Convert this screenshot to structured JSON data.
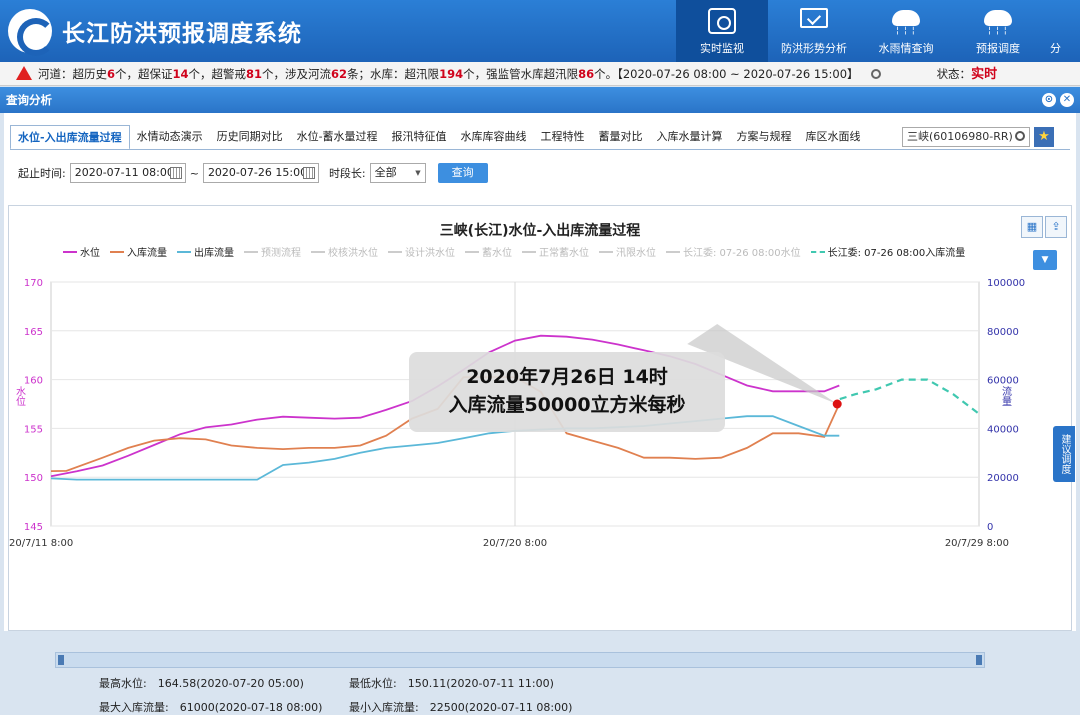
{
  "app": {
    "title": "长江防洪预报调度系统"
  },
  "nav": [
    {
      "label": "实时监视",
      "icon": "monitor-icon"
    },
    {
      "label": "防洪形势分析",
      "icon": "screen-icon"
    },
    {
      "label": "水雨情查询",
      "icon": "cloud-icon"
    },
    {
      "label": "预报调度",
      "icon": "cloud-icon"
    },
    {
      "label": "分",
      "icon": "gear-icon"
    }
  ],
  "alert": {
    "p1": "河道：超历史",
    "n1": "6",
    "p2": "个，超保证",
    "n2": "14",
    "p3": "个，超警戒",
    "n3": "81",
    "p4": "个，涉及河流",
    "n4": "62",
    "p5": "条；水库：超汛限",
    "n5": "194",
    "p6": "个，强监管水库超汛限",
    "n6": "86",
    "p7": "个。【2020-07-26 08:00 ~ 2020-07-26 15:00】",
    "status_label": "状态：",
    "status_value": "实时"
  },
  "panel": {
    "title": "查询分析"
  },
  "tabs": [
    "水位-入出库流量过程",
    "水情动态演示",
    "历史同期对比",
    "水位-蓄水量过程",
    "报汛特征值",
    "水库库容曲线",
    "工程特性",
    "蓄量对比",
    "入库水量计算",
    "方案与规程",
    "库区水面线"
  ],
  "station": "三峡(60106980-RR)",
  "filter": {
    "range_label": "起止时间:",
    "start": "2020-07-11 08:00",
    "sep": "~",
    "end": "2020-07-26 15:00",
    "period_label": "时段长:",
    "period_value": "全部",
    "query_label": "查询"
  },
  "chart_data": {
    "type": "line",
    "title": "三峡(长江)水位-入出库流量过程",
    "legend": [
      {
        "name": "水位",
        "color": "#cc33cc",
        "active": true
      },
      {
        "name": "入库流量",
        "color": "#e08050",
        "active": true
      },
      {
        "name": "出库流量",
        "color": "#5bb8d8",
        "active": true
      },
      {
        "name": "预测流程",
        "color": "#cccccc",
        "active": false
      },
      {
        "name": "校核洪水位",
        "color": "#cccccc",
        "active": false
      },
      {
        "name": "设计洪水位",
        "color": "#cccccc",
        "active": false
      },
      {
        "name": "蓄水位",
        "color": "#cccccc",
        "active": false
      },
      {
        "name": "正常蓄水位",
        "color": "#cccccc",
        "active": false
      },
      {
        "name": "汛限水位",
        "color": "#cccccc",
        "active": false
      },
      {
        "name": "长江委: 07-26 08:00水位",
        "color": "#cccccc",
        "active": false
      },
      {
        "name": "长江委: 07-26 08:00入库流量",
        "color": "#40c8b0",
        "active": true
      }
    ],
    "y_left": {
      "label": "水位",
      "ticks": [
        145,
        150,
        155,
        160,
        165,
        170
      ],
      "range": [
        145,
        170
      ]
    },
    "y_right": {
      "label": "流量",
      "ticks": [
        0,
        20000,
        40000,
        60000,
        80000,
        100000
      ],
      "range": [
        0,
        100000
      ]
    },
    "x_ticks": [
      "20/7/11 8:00",
      "20/7/20 8:00",
      "20/7/29 8:00"
    ],
    "x_range_days": [
      0,
      18
    ],
    "series": [
      {
        "name": "水位",
        "axis": "left",
        "color": "#cc33cc",
        "x": [
          0,
          0.5,
          1,
          1.5,
          2,
          2.5,
          3,
          3.5,
          4,
          4.5,
          5,
          5.5,
          6,
          6.5,
          7,
          7.5,
          8,
          8.5,
          9,
          9.5,
          10,
          10.5,
          11,
          11.5,
          12,
          12.5,
          13,
          13.5,
          14,
          14.5,
          15,
          15.29
        ],
        "y": [
          150.1,
          150.6,
          151.2,
          152.2,
          153.3,
          154.4,
          155.1,
          155.4,
          155.9,
          156.2,
          156.1,
          156.0,
          156.1,
          156.9,
          157.8,
          159.3,
          161.0,
          162.8,
          164.0,
          164.5,
          164.4,
          164.1,
          163.6,
          163.0,
          162.4,
          161.6,
          160.5,
          159.4,
          158.8,
          158.8,
          158.8,
          159.4
        ]
      },
      {
        "name": "入库流量",
        "axis": "right",
        "color": "#e08050",
        "x": [
          0,
          0.3,
          1,
          1.5,
          2,
          2.5,
          3,
          3.5,
          4,
          4.5,
          5,
          5.5,
          6,
          6.5,
          7,
          7.5,
          8,
          8.5,
          9,
          9.5,
          10,
          10.5,
          11,
          11.5,
          12,
          12.5,
          13,
          13.5,
          14,
          14.5,
          15,
          15.29
        ],
        "y": [
          22500,
          22600,
          28000,
          32000,
          35000,
          36000,
          35500,
          33000,
          32000,
          31500,
          32000,
          32000,
          33000,
          37000,
          44000,
          48000,
          61000,
          61000,
          61000,
          55000,
          38000,
          35000,
          32000,
          28000,
          28000,
          27500,
          28000,
          32000,
          38000,
          38000,
          36500,
          50000
        ]
      },
      {
        "name": "出库流量",
        "axis": "right",
        "color": "#5bb8d8",
        "x": [
          0,
          0.5,
          1,
          2,
          3,
          3.5,
          4,
          4.5,
          5,
          5.5,
          6,
          6.5,
          7,
          7.5,
          8,
          8.5,
          9,
          9.5,
          10,
          10.5,
          11,
          11.5,
          12,
          12.5,
          13,
          13.5,
          14,
          14.5,
          15,
          15.29
        ],
        "y": [
          19500,
          19000,
          19000,
          19000,
          19000,
          19000,
          19000,
          25000,
          26000,
          27500,
          30000,
          32000,
          33000,
          34000,
          36000,
          38000,
          39000,
          39500,
          40000,
          40000,
          40500,
          41000,
          42000,
          43000,
          44000,
          45000,
          45000,
          41000,
          37000,
          37000
        ]
      },
      {
        "name": "长江委: 07-26 08:00入库流量",
        "axis": "right",
        "color": "#40c8b0",
        "dashed": true,
        "x": [
          15.3,
          15.6,
          16,
          16.5,
          17,
          17.5,
          18
        ],
        "y": [
          52000,
          54000,
          56000,
          60000,
          60000,
          54000,
          46000
        ]
      }
    ],
    "highlight_point": {
      "series": "入库流量",
      "x": 15.25,
      "y": 50000
    },
    "annotation": [
      "2020年7月26日 14时",
      "入库流量50000立方米每秒"
    ]
  },
  "stats": {
    "max_level": "最高水位:　164.58(2020-07-20 05:00)",
    "min_level": "最低水位:　150.11(2020-07-11 11:00)",
    "max_inflow": "最大入库流量:　61000(2020-07-18 08:00)",
    "min_inflow": "最小入库流量:　22500(2020-07-11 08:00)"
  },
  "side_tab": "建议调度"
}
